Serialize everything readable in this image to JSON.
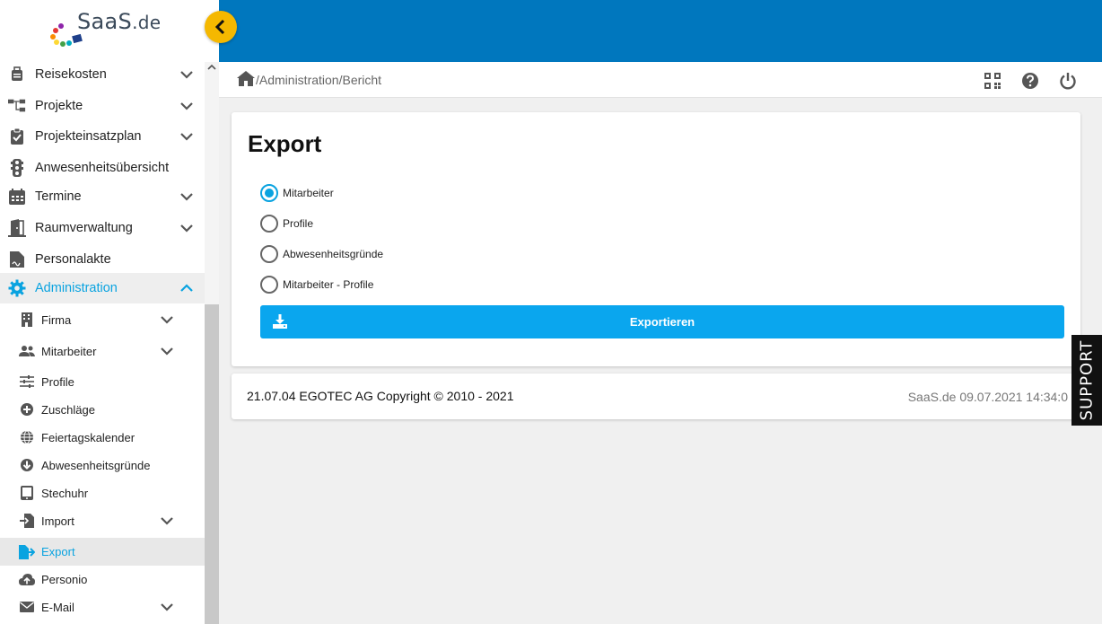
{
  "brand": {
    "name": "SaaS",
    "tld": ".de"
  },
  "menu": {
    "items": [
      {
        "label": "Reisekosten",
        "icon": "suitcase-icon",
        "expandable": true
      },
      {
        "label": "Projekte",
        "icon": "project-tree-icon",
        "expandable": true
      },
      {
        "label": "Projekteinsatzplan",
        "icon": "clipboard-check-icon",
        "expandable": true
      },
      {
        "label": "Anwesenheitsübersicht",
        "icon": "traffic-light-icon",
        "expandable": false
      },
      {
        "label": "Termine",
        "icon": "calendar-icon",
        "expandable": true
      },
      {
        "label": "Raumverwaltung",
        "icon": "door-icon",
        "expandable": true
      },
      {
        "label": "Personalakte",
        "icon": "file-signature-icon",
        "expandable": false
      },
      {
        "label": "Administration",
        "icon": "gear-icon",
        "expandable": true,
        "open": true
      }
    ],
    "subitems": [
      {
        "label": "Firma",
        "icon": "building-icon",
        "expandable": true
      },
      {
        "label": "Mitarbeiter",
        "icon": "users-icon",
        "expandable": true
      },
      {
        "label": "Profile",
        "icon": "sliders-icon",
        "expandable": false
      },
      {
        "label": "Zuschläge",
        "icon": "plus-circle-icon",
        "expandable": false
      },
      {
        "label": "Feiertagskalender",
        "icon": "globe-icon",
        "expandable": false
      },
      {
        "label": "Abwesenheitsgründe",
        "icon": "arrow-down-circle-icon",
        "expandable": false
      },
      {
        "label": "Stechuhr",
        "icon": "tablet-icon",
        "expandable": false
      },
      {
        "label": "Import",
        "icon": "file-import-icon",
        "expandable": true
      },
      {
        "label": "Export",
        "icon": "file-export-icon",
        "expandable": false,
        "current": true
      },
      {
        "label": "Personio",
        "icon": "cloud-upload-icon",
        "expandable": false
      },
      {
        "label": "E-Mail",
        "icon": "envelope-icon",
        "expandable": true
      }
    ]
  },
  "breadcrumb": {
    "path": "/Administration/Bericht"
  },
  "header_icons": [
    "qr-code-icon",
    "help-icon",
    "power-icon"
  ],
  "export": {
    "title": "Export",
    "options": [
      {
        "label": "Mitarbeiter",
        "checked": true
      },
      {
        "label": "Profile",
        "checked": false
      },
      {
        "label": "Abwesenheitsgründe",
        "checked": false
      },
      {
        "label": "Mitarbeiter - Profile",
        "checked": false
      }
    ],
    "button_label": "Exportieren"
  },
  "footer": {
    "left": "21.07.04 EGOTEC AG Copyright © 2010 - 2021",
    "right": "SaaS.de  09.07.2021 14:34:0"
  },
  "support_label": "SUPPORT",
  "colors": {
    "header": "#0077be",
    "accent": "#0aa3e0",
    "button": "#0aa6ee",
    "collapse": "#f5b800"
  }
}
